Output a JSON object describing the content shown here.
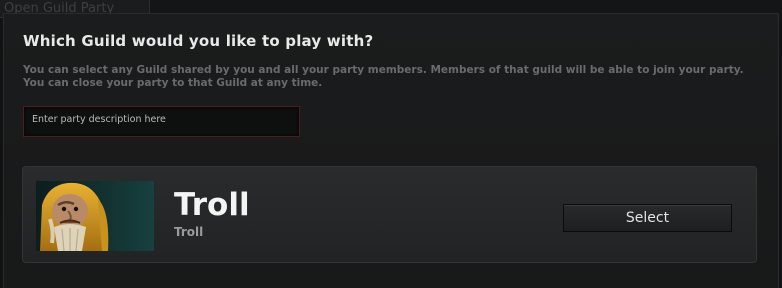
{
  "window": {
    "title": "Open Guild Party"
  },
  "dialog": {
    "heading": "Which Guild would you like to play with?",
    "description": "You can select any Guild shared by you and all your party members.  Members of that guild will be able to join your party.  You can close your party to that Guild at any time.",
    "party_description": {
      "value": "",
      "placeholder": "Enter party description here"
    }
  },
  "guilds": [
    {
      "name": "Troll",
      "tag": "Troll",
      "emblem_icon": "hero-portrait-icon",
      "select_label": "Select"
    }
  ],
  "colors": {
    "background": "#1a1b1c",
    "card": "#262728",
    "input_border": "#4a1e1e"
  }
}
